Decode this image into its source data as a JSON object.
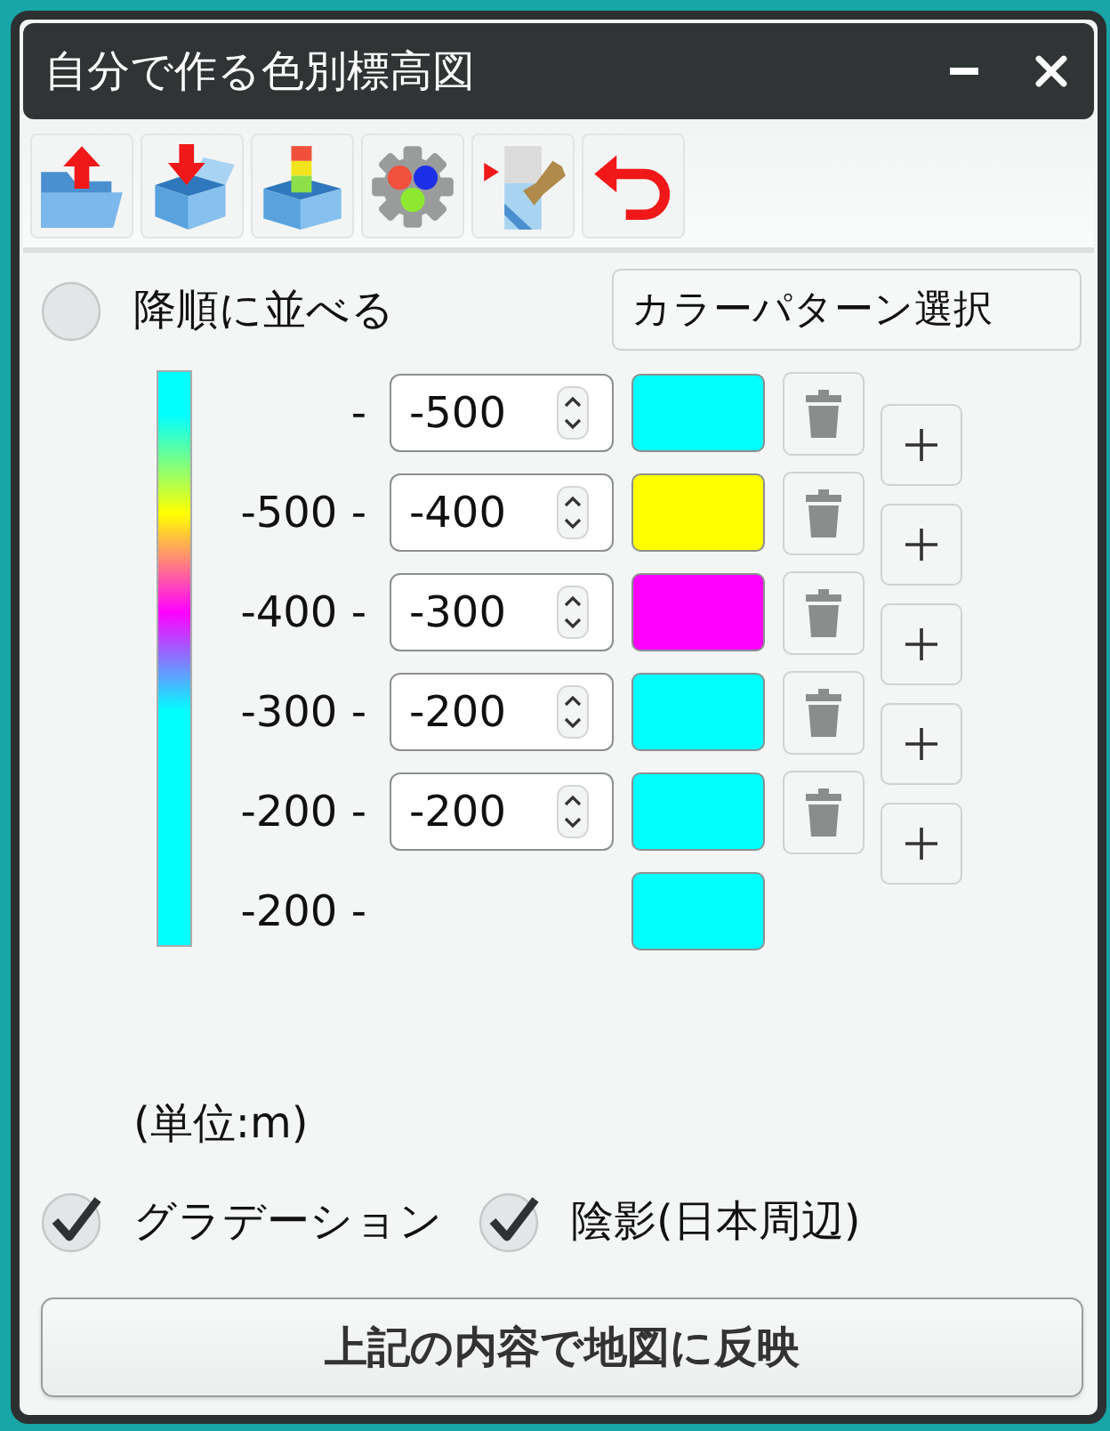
{
  "window": {
    "title": "自分で作る色別標高図"
  },
  "sort": {
    "label": "降順に並べる",
    "checked": false
  },
  "color_pattern_button": {
    "label": "カラーパターン選択"
  },
  "rows": [
    {
      "kind": "editable",
      "range": "-",
      "value": "-500",
      "color": "#00ffff"
    },
    {
      "kind": "editable",
      "range": "-500 -",
      "value": "-400",
      "color": "#ffff00"
    },
    {
      "kind": "editable",
      "range": "-400 -",
      "value": "-300",
      "color": "#ff00ff"
    },
    {
      "kind": "editable",
      "range": "-300 -",
      "value": "-200",
      "color": "#00ffff"
    },
    {
      "kind": "editable",
      "range": "-200 -",
      "value": "-200",
      "color": "#00ffff"
    },
    {
      "kind": "fixed",
      "range": "-200 -",
      "color": "#00ffff"
    }
  ],
  "unit_label": "(単位:m)",
  "options": [
    {
      "label": "グラデーション",
      "checked": true
    },
    {
      "label": "陰影(日本周辺)",
      "checked": true
    }
  ],
  "apply_button": {
    "label": "上記の内容で地図に反映"
  }
}
